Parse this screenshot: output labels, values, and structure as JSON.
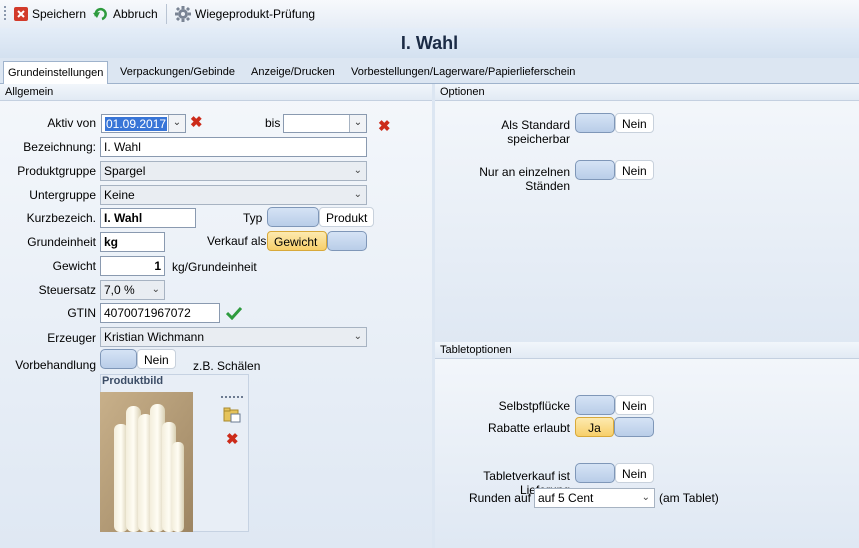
{
  "toolbar": {
    "save_label": "Speichern",
    "cancel_label": "Abbruch",
    "check_label": "Wiegeprodukt-Prüfung"
  },
  "header": {
    "title": "I. Wahl"
  },
  "tabs": [
    {
      "label": "Grundeinstellungen",
      "active": true
    },
    {
      "label": "Verpackungen/Gebinde"
    },
    {
      "label": "Anzeige/Drucken"
    },
    {
      "label": "Vorbestellungen/Lagerware/Papierlieferschein"
    }
  ],
  "allgemein": {
    "header": "Allgemein",
    "aktiv_von_label": "Aktiv von",
    "aktiv_von_value": "01.09.2017",
    "bis_label": "bis",
    "bis_value": "",
    "bezeichnung_label": "Bezeichnung:",
    "bezeichnung_value": "I. Wahl",
    "produktgruppe_label": "Produktgruppe",
    "produktgruppe_value": "Spargel",
    "untergruppe_label": "Untergruppe",
    "untergruppe_value": "Keine",
    "kurzbez_label": "Kurzbezeich.",
    "kurzbez_value": "I. Wahl",
    "typ_label": "Typ",
    "typ_value": "Produkt",
    "grundeinheit_label": "Grundeinheit",
    "grundeinheit_value": "kg",
    "verkauf_label": "Verkauf als",
    "verkauf_value": "Gewicht",
    "gewicht_label": "Gewicht",
    "gewicht_value": "1",
    "gewicht_unit": "kg/Grundeinheit",
    "steuersatz_label": "Steuersatz",
    "steuersatz_value": "7,0 %",
    "gtin_label": "GTIN",
    "gtin_value": "4070071967072",
    "erzeuger_label": "Erzeuger",
    "erzeuger_value": "Kristian Wichmann",
    "vorbehandlung_label": "Vorbehandlung",
    "vorbehandlung_value": "Nein",
    "vorbehandlung_hint": "z.B. Schälen",
    "produktbild_label": "Produktbild"
  },
  "optionen": {
    "header": "Optionen",
    "standard_label": "Als Standard speicherbar",
    "standard_value": "Nein",
    "staende_label": "Nur an einzelnen Ständen",
    "staende_value": "Nein"
  },
  "tablet": {
    "header": "Tabletoptionen",
    "selbst_label": "Selbstpflücke",
    "selbst_value": "Nein",
    "rabatte_label": "Rabatte erlaubt",
    "rabatte_value": "Ja",
    "liefer_label": "Tabletverkauf ist Lieferung",
    "liefer_value": "Nein",
    "runden_label": "Runden auf",
    "runden_value": "auf 5 Cent",
    "runden_hint": "(am Tablet)"
  },
  "colors": {
    "accent": "#f7cf6a",
    "delete": "#cc2b1a",
    "ok": "#2e9b3e"
  }
}
